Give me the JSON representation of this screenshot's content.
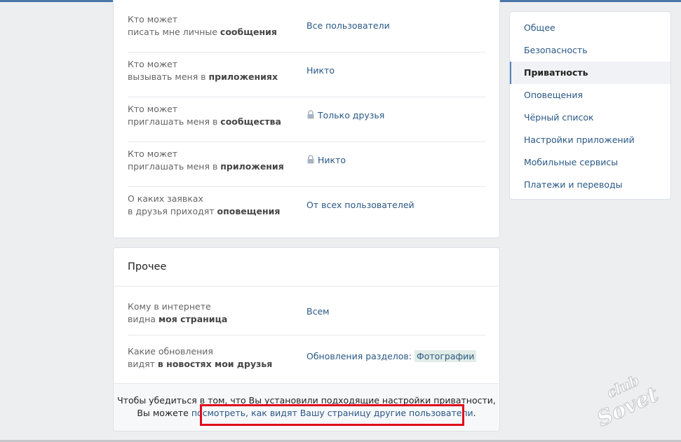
{
  "privacy_rows": [
    {
      "label_pre": "Кто может",
      "label_mid": "писать мне личные ",
      "label_bold": "сообщения",
      "value": "Все пользователи",
      "locked": false
    },
    {
      "label_pre": "Кто может",
      "label_mid": "вызывать меня в ",
      "label_bold": "приложениях",
      "value": "Никто",
      "locked": false
    },
    {
      "label_pre": "Кто может",
      "label_mid": "приглашать меня в ",
      "label_bold": "сообщества",
      "value": "Только друзья",
      "locked": true
    },
    {
      "label_pre": "Кто может",
      "label_mid": "приглашать меня в ",
      "label_bold": "приложения",
      "value": "Никто",
      "locked": true
    },
    {
      "label_pre": "О каких заявках",
      "label_mid": "в друзья приходят ",
      "label_bold": "оповещения",
      "value": "От всех пользователей",
      "locked": false
    }
  ],
  "other": {
    "title": "Прочее",
    "rows": [
      {
        "label_pre": "Кому в интернете",
        "label_mid": "видна ",
        "label_bold": "моя страница",
        "value": "Всем"
      },
      {
        "label_pre": "Какие обновления",
        "label_mid": "видят ",
        "label_bold": "в новостях мои друзья",
        "value": "Обновления разделов:",
        "tag": "Фотографии"
      }
    ],
    "footer": {
      "line1": "Чтобы убедиться в том, что Вы установили подходящие настройки приватности,",
      "line2_prefix": "Вы можете ",
      "link": "посмотреть, как видят Вашу страницу другие пользователи",
      "line2_suffix": "."
    }
  },
  "menu": {
    "items": [
      "Общее",
      "Безопасность",
      "Приватность",
      "Оповещения",
      "Чёрный список",
      "Настройки приложений",
      "Мобильные сервисы",
      "Платежи и переводы"
    ],
    "active": "Приватность"
  },
  "watermark": {
    "text": "club Sovet"
  },
  "colors": {
    "accent": "#2a5885",
    "highlight_box": "#e00b1c",
    "background": "#edeef0"
  }
}
